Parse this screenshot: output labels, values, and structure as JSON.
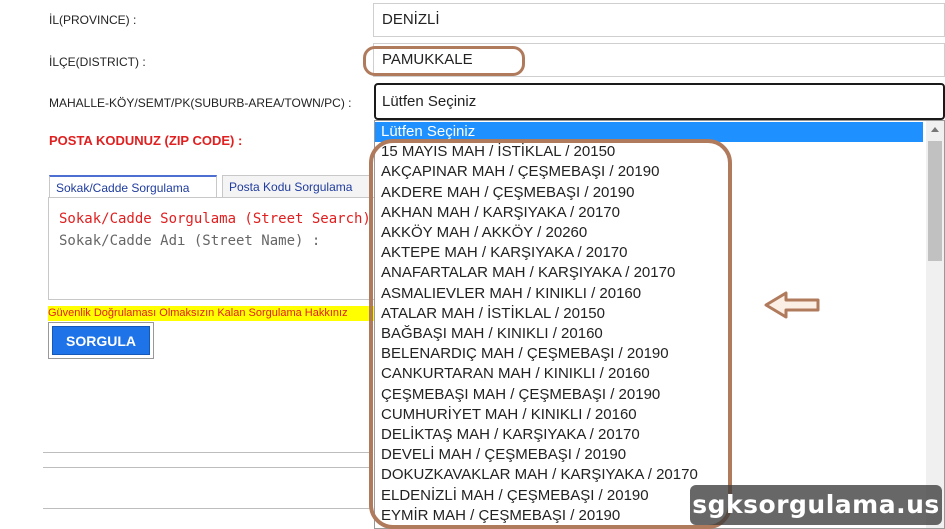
{
  "form": {
    "province_label": "İL(PROVINCE) :",
    "province_value": "DENİZLİ",
    "district_label": "İLÇE(DISTRICT) :",
    "district_value": "PAMUKKALE",
    "suburb_label": "MAHALLE-KÖY/SEMT/PK(SUBURB-AREA/TOWN/PC) :",
    "suburb_selected": "Lütfen Seçiniz",
    "zip_label": "POSTA KODUNUZ (ZIP CODE) :"
  },
  "tabs": [
    {
      "label": "Sokak/Cadde Sorgulama"
    },
    {
      "label": "Posta Kodu Sorgulama"
    }
  ],
  "street_panel": {
    "title": "Sokak/Cadde Sorgulama (Street Search)",
    "field_label": "Sokak/Cadde Adı (Street Name) :"
  },
  "warning": "Güvenlik Doğrulaması Olmaksızın Kalan Sorgulama Hakkınız",
  "search_button": "SORGULA",
  "dropdown": {
    "options": [
      "Lütfen Seçiniz",
      "15 MAYIS MAH / İSTİKLAL / 20150",
      "AKÇAPINAR MAH / ÇEŞMEBAŞI / 20190",
      "AKDERE MAH / ÇEŞMEBAŞI / 20190",
      "AKHAN MAH / KARŞIYAKA / 20170",
      "AKKÖY MAH / AKKÖY / 20260",
      "AKTEPE MAH / KARŞIYAKA / 20170",
      "ANAFARTALAR MAH / KARŞIYAKA / 20170",
      "ASMALIEVLER MAH / KINIKLI / 20160",
      "ATALAR MAH / İSTİKLAL / 20150",
      "BAĞBAŞI MAH / KINIKLI / 20160",
      "BELENARDIÇ MAH / ÇEŞMEBAŞI / 20190",
      "CANKURTARAN MAH / KINIKLI / 20160",
      "ÇEŞMEBAŞI MAH / ÇEŞMEBAŞI / 20190",
      "CUMHURİYET MAH / KINIKLI / 20160",
      "DELİKTAŞ MAH / KARŞIYAKA / 20170",
      "DEVELİ MAH / ÇEŞMEBAŞI / 20190",
      "DOKUZKAVAKLAR MAH / KARŞIYAKA / 20170",
      "ELDENİZLİ MAH / ÇEŞMEBAŞI / 20190",
      "EYMİR MAH / ÇEŞMEBAŞI / 20190"
    ]
  },
  "watermark": "sgksorgulama.us",
  "colors": {
    "highlight": "#b07a5c",
    "selected_option": "#1e90ff",
    "button": "#1e73e8",
    "zip_label": "#e02020"
  }
}
